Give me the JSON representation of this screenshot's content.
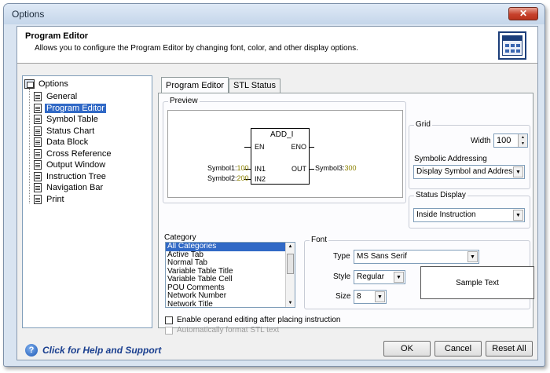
{
  "window": {
    "title": "Options",
    "close": "✕"
  },
  "header": {
    "title": "Program Editor",
    "description": "Allows you to configure the Program Editor by changing font, color, and other display options."
  },
  "tree": {
    "root": "Options",
    "items": [
      {
        "label": "General"
      },
      {
        "label": "Program Editor",
        "selected": true
      },
      {
        "label": "Symbol Table"
      },
      {
        "label": "Status Chart"
      },
      {
        "label": "Data Block"
      },
      {
        "label": "Cross Reference"
      },
      {
        "label": "Output Window"
      },
      {
        "label": "Instruction Tree"
      },
      {
        "label": "Navigation Bar"
      },
      {
        "label": "Print"
      }
    ]
  },
  "tabs": [
    {
      "label": "Program Editor",
      "active": true
    },
    {
      "label": "STL Status"
    }
  ],
  "preview": {
    "label": "Preview",
    "block_name": "ADD_I",
    "en": "EN",
    "eno": "ENO",
    "in1": "IN1",
    "in2": "IN2",
    "out": "OUT",
    "sym1": "Symbol1:",
    "sym1_val": "100",
    "sym2": "Symbol2:",
    "sym2_val": "200",
    "sym3": "Symbol3:",
    "sym3_val": "300"
  },
  "grid": {
    "label": "Grid",
    "width_label": "Width",
    "width_value": "100",
    "symbolic_label": "Symbolic Addressing",
    "symbolic_value": "Display Symbol and Address"
  },
  "status_display": {
    "label": "Status Display",
    "value": "Inside Instruction"
  },
  "category": {
    "label": "Category",
    "items": [
      "All Categories",
      "Active Tab",
      "Normal Tab",
      "Variable Table Title",
      "Variable Table Cell",
      "POU Comments",
      "Network Number",
      "Network Title"
    ]
  },
  "font": {
    "label": "Font",
    "type_label": "Type",
    "type_value": "MS Sans Serif",
    "style_label": "Style",
    "style_value": "Regular",
    "size_label": "Size",
    "size_value": "8",
    "sample": "Sample Text"
  },
  "options": {
    "enable_operand": "Enable operand editing after placing instruction",
    "auto_format": "Automatically format STL text"
  },
  "footer": {
    "help": "Click for Help and Support",
    "ok": "OK",
    "cancel": "Cancel",
    "reset": "Reset All"
  }
}
